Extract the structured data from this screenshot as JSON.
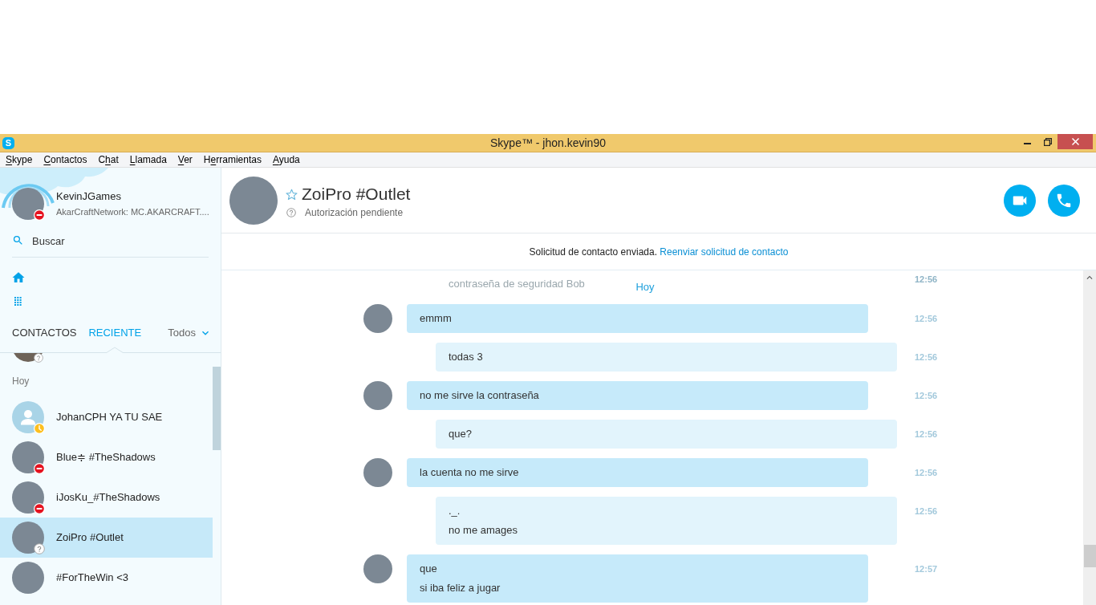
{
  "window": {
    "logo_text": "S",
    "title": "Skype™ - jhon.kevin90"
  },
  "menu": [
    {
      "access_key": "S",
      "label_end": "kype"
    },
    {
      "access_key": "C",
      "label_end": "ontactos"
    },
    {
      "label_start": "C",
      "access_key": "h",
      "label_end": "at"
    },
    {
      "access_key": "L",
      "label_end": "lamada"
    },
    {
      "access_key": "V",
      "label_end": "er"
    },
    {
      "label_start": "H",
      "access_key": "e",
      "label_end": "rramientas"
    },
    {
      "access_key": "A",
      "label_end": "yuda"
    }
  ],
  "profile": {
    "name": "KevinJGames",
    "mood": "AkarCraftNetwork: MC.AKARCRAFT....",
    "photo": true,
    "badge": {
      "kind": "busy"
    }
  },
  "search": {
    "placeholder": "Buscar"
  },
  "tabs": [
    {
      "label": "CONTACTOS",
      "selected": false
    },
    {
      "label": "RECIENTE",
      "selected": true
    }
  ],
  "filter": {
    "label": "Todos"
  },
  "recent": {
    "cut_off_item": {
      "photo": true,
      "badge": {
        "kind": "pending"
      }
    },
    "group": "Hoy",
    "items": [
      {
        "name": "JohanCPH YA TU SAE",
        "photo": false,
        "badge": {
          "kind": "away"
        },
        "selected": false
      },
      {
        "name": "Blue≑ #TheShadows",
        "photo": true,
        "badge": {
          "kind": "busy"
        },
        "selected": false
      },
      {
        "name": "iJosKu_#TheShadows",
        "photo": true,
        "badge": {
          "kind": "busy"
        },
        "selected": false
      },
      {
        "name": "ZoiPro #Outlet",
        "photo": true,
        "badge": {
          "kind": "pending"
        },
        "selected": true
      },
      {
        "name": "#ForTheWin <3",
        "photo": true,
        "selected": false
      }
    ]
  },
  "chat": {
    "contact": {
      "name": "ZoiPro #Outlet",
      "favorite": false,
      "status_text": "Autorización pendiente"
    },
    "notice": {
      "text": "Solicitud de contacto enviada.",
      "link": "Reenviar solicitud de contacto"
    },
    "faded_message": {
      "text": "contraseña de seguridad Bob",
      "time": "12:56"
    },
    "day": "Hoy",
    "messages": [
      {
        "kind": "incoming",
        "lines": [
          "emmm"
        ],
        "time": "12:56"
      },
      {
        "kind": "outgoing",
        "lines": [
          "todas 3"
        ],
        "time": "12:56"
      },
      {
        "kind": "incoming",
        "lines": [
          "no me sirve la contraseña"
        ],
        "time": "12:56"
      },
      {
        "kind": "outgoing",
        "lines": [
          "que?"
        ],
        "time": "12:56"
      },
      {
        "kind": "incoming",
        "lines": [
          "la cuenta no me sirve"
        ],
        "time": "12:56"
      },
      {
        "kind": "outgoing",
        "lines": [
          "._.",
          "no me amages"
        ],
        "time": "12:56"
      },
      {
        "kind": "incoming",
        "lines": [
          "que",
          "si iba feliz a jugar"
        ],
        "time": "12:57"
      }
    ]
  }
}
